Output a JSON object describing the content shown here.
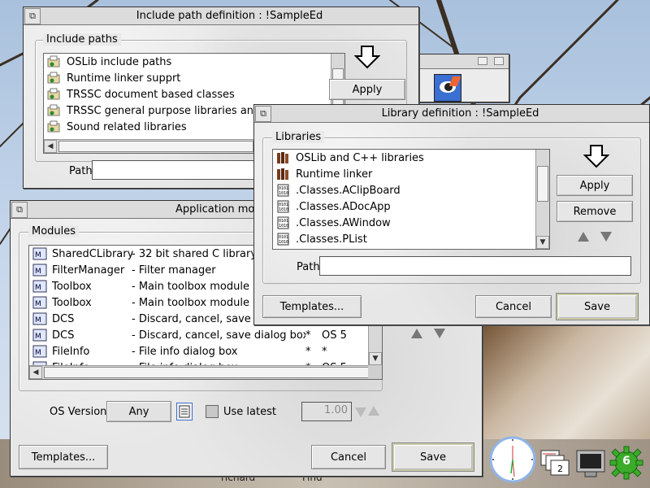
{
  "include_window": {
    "title": "Include path definition : !SampleEd",
    "group_label": "Include paths",
    "items": [
      {
        "label": "OSLib include paths"
      },
      {
        "label": "Runtime linker supprt"
      },
      {
        "label": "TRSSC document based classes"
      },
      {
        "label": "TRSSC general purpose libraries and cla"
      },
      {
        "label": "Sound related libraries"
      }
    ],
    "apply_label": "Apply",
    "path_label": "Path",
    "path_value": ""
  },
  "library_window": {
    "title": "Library definition : !SampleEd",
    "group_label": "Libraries",
    "items": [
      {
        "label": "OSLib and C++ libraries",
        "icon": "books-icon"
      },
      {
        "label": "Runtime linker",
        "icon": "books-icon"
      },
      {
        "label": ".Classes.AClipBoard",
        "icon": "binary-file-icon"
      },
      {
        "label": ".Classes.ADocApp",
        "icon": "binary-file-icon"
      },
      {
        "label": ".Classes.AWindow",
        "icon": "binary-file-icon"
      },
      {
        "label": ".Classes.PList",
        "icon": "binary-file-icon"
      }
    ],
    "apply_label": "Apply",
    "remove_label": "Remove",
    "path_label": "Path",
    "path_value": "",
    "templates_label": "Templates...",
    "cancel_label": "Cancel",
    "save_label": "Save"
  },
  "modules_window": {
    "title": "Application mod",
    "group_label": "Modules",
    "rows": [
      {
        "name": "SharedCLibrary",
        "desc": "- 32 bit shared C library",
        "flag": "",
        "os": ""
      },
      {
        "name": "FilterManager",
        "desc": "- Filter manager",
        "flag": "",
        "os": ""
      },
      {
        "name": "Toolbox",
        "desc": "- Main toolbox module",
        "flag": "",
        "os": ""
      },
      {
        "name": "Toolbox",
        "desc": "- Main toolbox module",
        "flag": "",
        "os": ""
      },
      {
        "name": "DCS",
        "desc": "- Discard, cancel, save dial",
        "flag": "",
        "os": ""
      },
      {
        "name": "DCS",
        "desc": "- Discard, cancel, save dialog box",
        "flag": "*",
        "os": "OS 5"
      },
      {
        "name": "FileInfo",
        "desc": "- File info dialog box",
        "flag": "*",
        "os": "*"
      },
      {
        "name": "FileInfo",
        "desc": "- File info dialog box",
        "flag": "*",
        "os": "OS 5"
      }
    ],
    "os_version_label": "OS Version",
    "os_version_value": "Any",
    "use_latest_label": "Use latest",
    "version_value": "1.00",
    "templates_label": "Templates...",
    "cancel_label": "Cancel",
    "save_label": "Save"
  },
  "desktop": {
    "bottom_labels": [
      "richard",
      "Find"
    ],
    "taskmanager_badge": "2",
    "config_badge": "6"
  }
}
